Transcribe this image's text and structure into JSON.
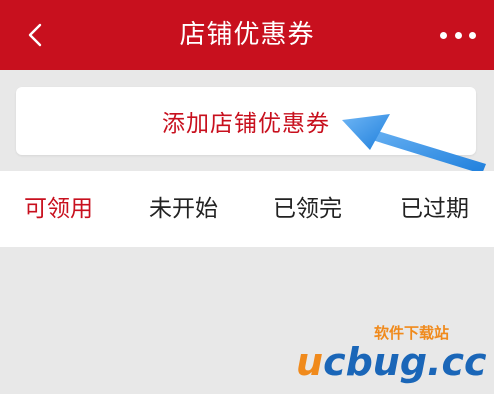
{
  "header": {
    "title": "店铺优惠券",
    "back_icon": "chevron-left-icon",
    "more_icon": "more-horizontal-icon",
    "background_color": "#c8101e"
  },
  "add_coupon": {
    "label": "添加店铺优惠券",
    "color": "#c8101e"
  },
  "tabs": [
    {
      "label": "可领用",
      "active": true
    },
    {
      "label": "未开始",
      "active": false
    },
    {
      "label": "已领完",
      "active": false
    },
    {
      "label": "已过期",
      "active": false
    }
  ],
  "annotation": {
    "arrow_icon": "pointer-arrow-icon",
    "arrow_color": "#2d8fe6"
  },
  "watermark": {
    "top_text": "软件下载站",
    "brand_u": "u",
    "brand_rest": "cbug",
    "brand_tld": ".cc"
  }
}
